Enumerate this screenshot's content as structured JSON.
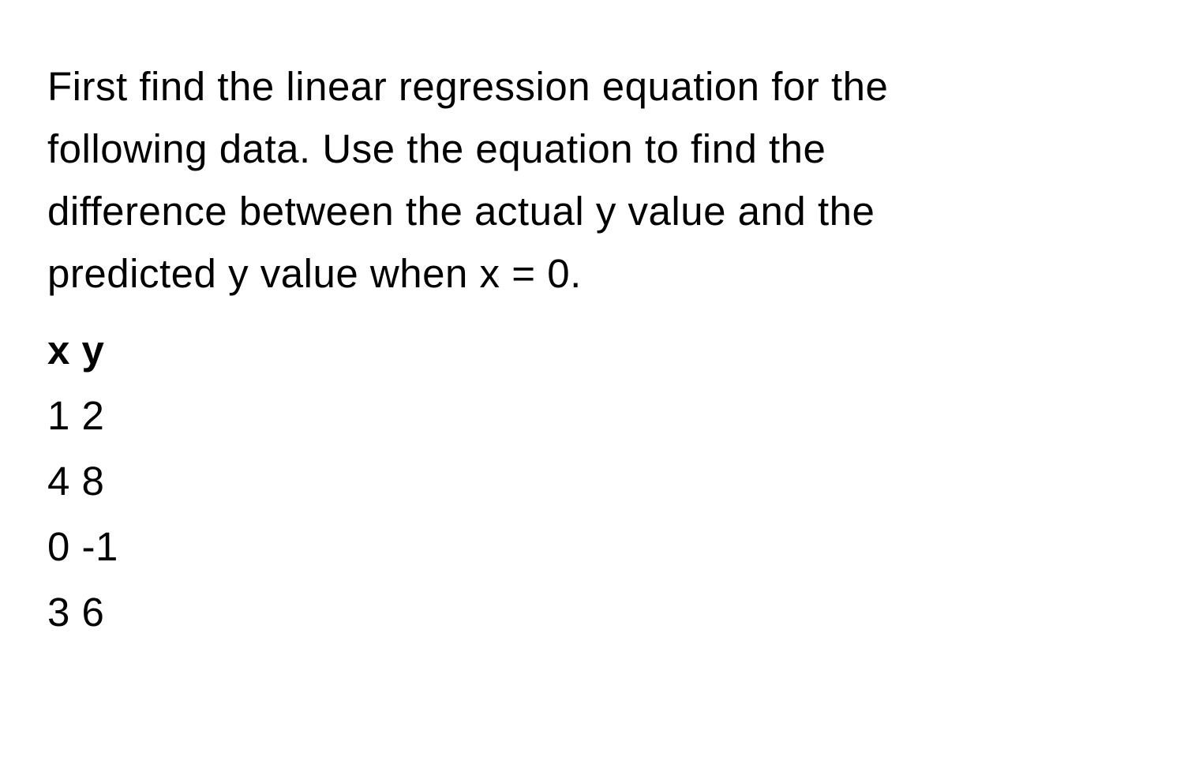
{
  "question": {
    "line1": "First find the linear regression equation for the",
    "line2": "following data. Use the equation to find the",
    "line3": "difference between the actual y value and the",
    "line4": "predicted y value when x = 0."
  },
  "table": {
    "header": "x y",
    "rows": [
      "1 2",
      "4 8",
      "0 -1",
      "3 6"
    ]
  }
}
